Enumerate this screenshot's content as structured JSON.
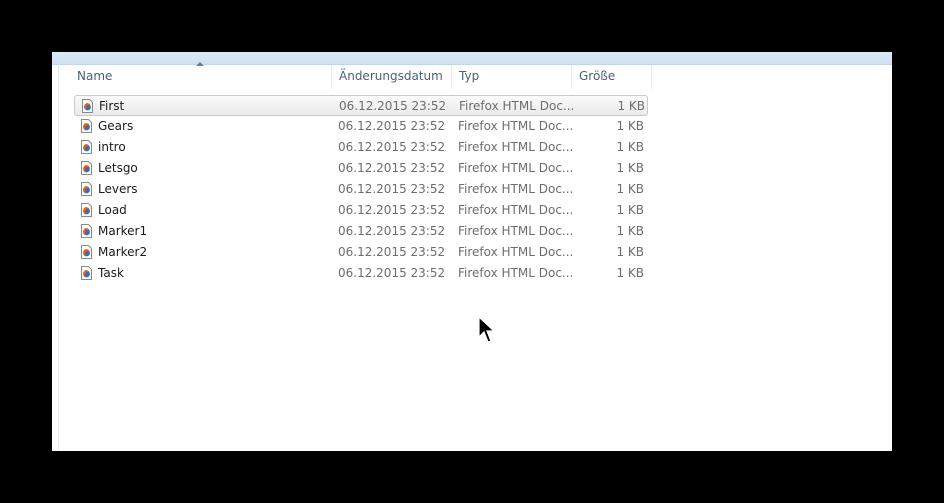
{
  "columns": {
    "name": "Name",
    "date": "Änderungsdatum",
    "type": "Typ",
    "size": "Größe"
  },
  "files": [
    {
      "name": "First",
      "date": "06.12.2015 23:52",
      "type": "Firefox HTML Doc...",
      "size": "1 KB",
      "selected": true
    },
    {
      "name": "Gears",
      "date": "06.12.2015 23:52",
      "type": "Firefox HTML Doc...",
      "size": "1 KB"
    },
    {
      "name": "intro",
      "date": "06.12.2015 23:52",
      "type": "Firefox HTML Doc...",
      "size": "1 KB"
    },
    {
      "name": "Letsgo",
      "date": "06.12.2015 23:52",
      "type": "Firefox HTML Doc...",
      "size": "1 KB"
    },
    {
      "name": "Levers",
      "date": "06.12.2015 23:52",
      "type": "Firefox HTML Doc...",
      "size": "1 KB"
    },
    {
      "name": "Load",
      "date": "06.12.2015 23:52",
      "type": "Firefox HTML Doc...",
      "size": "1 KB"
    },
    {
      "name": "Marker1",
      "date": "06.12.2015 23:52",
      "type": "Firefox HTML Doc...",
      "size": "1 KB"
    },
    {
      "name": "Marker2",
      "date": "06.12.2015 23:52",
      "type": "Firefox HTML Doc...",
      "size": "1 KB"
    },
    {
      "name": "Task",
      "date": "06.12.2015 23:52",
      "type": "Firefox HTML Doc...",
      "size": "1 KB"
    }
  ],
  "icons": {
    "file": "firefox-html-file-icon",
    "cursor": "mouse-pointer-icon"
  },
  "colors": {
    "background": "#000000",
    "window": "#ffffff",
    "header_text": "#4c607a",
    "selected_row": "#eaeaea"
  }
}
